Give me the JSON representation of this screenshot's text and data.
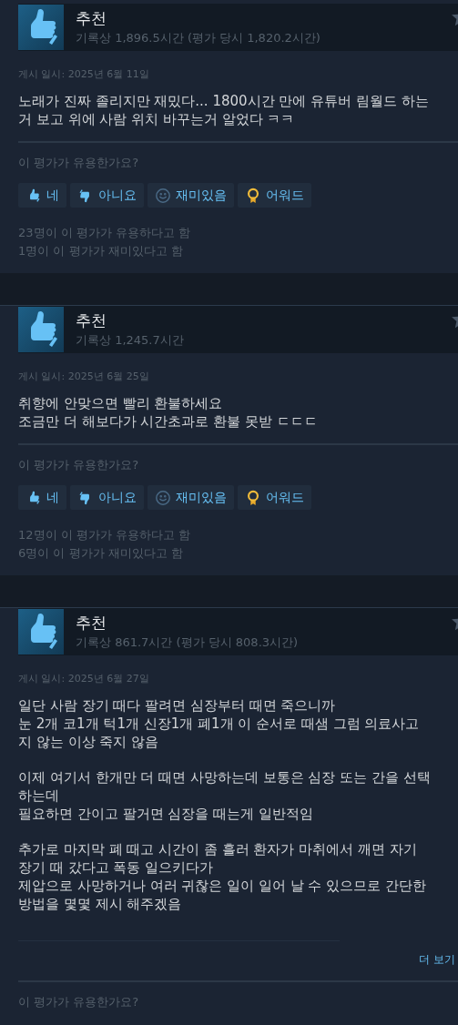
{
  "reviews": [
    {
      "recommended": true,
      "verdict": "추천",
      "hours": "기록상 1,896.5시간 (평가 당시 1,820.2시간)",
      "posted": "게시 일시: 2025년 6월 11일",
      "body": [
        [
          "노래가 진짜 졸리지만 재밌다... 1800시간 만에 유튜버 림월드 하는",
          "거 보고 위에 사람 위치 바꾸는거 알었다 ㅋㅋ"
        ]
      ],
      "prompt": "이 평가가 유용한가요?",
      "votes": [
        {
          "kind": "yes",
          "label": "네"
        },
        {
          "kind": "no",
          "label": "아니요"
        },
        {
          "kind": "funny",
          "label": "재미있음"
        },
        {
          "kind": "award",
          "label": "어워드"
        }
      ],
      "counts": [
        "23명이 이 평가가 유용하다고 함",
        "1명이 이 평가가 재미있다고 함"
      ]
    },
    {
      "recommended": true,
      "verdict": "추천",
      "hours": "기록상 1,245.7시간",
      "posted": "게시 일시: 2025년 6월 25일",
      "body": [
        [
          "취향에 안맞으면 빨리 환불하세요",
          "조금만 더 해보다가 시간초과로 환불 못받 ㄷㄷㄷ"
        ]
      ],
      "prompt": "이 평가가 유용한가요?",
      "votes": [
        {
          "kind": "yes",
          "label": "네"
        },
        {
          "kind": "no",
          "label": "아니요"
        },
        {
          "kind": "funny",
          "label": "재미있음"
        },
        {
          "kind": "award",
          "label": "어워드"
        }
      ],
      "counts": [
        "12명이 이 평가가 유용하다고 함",
        "6명이 이 평가가 재미있다고 함"
      ]
    },
    {
      "recommended": true,
      "verdict": "추천",
      "hours": "기록상 861.7시간 (평가 당시 808.3시간)",
      "posted": "게시 일시: 2025년 6월 27일",
      "body": [
        [
          "일단 사람 장기 때다 팔려면 심장부터 때면 죽으니까",
          "눈 2개 코1개 턱1개 신장1개 폐1개 이 순서로 때샘 그럼 의료사고",
          "지 않는 이상 죽지 않음"
        ],
        [
          "이제 여기서 한개만 더 때면 사망하는데 보통은 심장 또는 간을 선택",
          "하는데",
          "필요하면 간이고 팔거면 심장을 때는게 일반적임"
        ],
        [
          "추가로 마지막 폐 때고 시간이 좀 흘러 환자가 마취에서 깨면 자기",
          "장기 때 갔다고 폭동 일으키다가",
          "제압으로 사망하거나 여러 귀찮은 일이 일어 날 수 있으므로 간단한",
          "방법을 몇몇 제시 해주겠음"
        ]
      ],
      "read_more": "더 보기",
      "prompt": "이 평가가 유용한가요?"
    }
  ]
}
